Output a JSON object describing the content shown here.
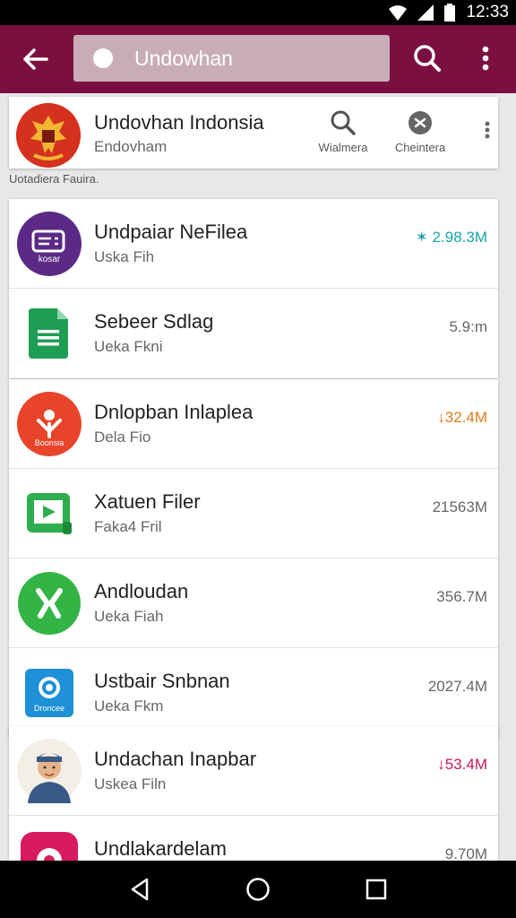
{
  "status_bar": {
    "time": "12:33"
  },
  "app_bar": {
    "search_text": "Undowhan"
  },
  "header": {
    "title": "Undovhan Indonsia",
    "subtitle": "Endovham",
    "actions": [
      {
        "label": "Wialmera",
        "icon": "search-icon"
      },
      {
        "label": "Cheintera",
        "icon": "settings-icon"
      }
    ]
  },
  "section_label": "Uotadiera Fauira.",
  "items": [
    {
      "name": "Undpaiar NeFilea",
      "sub": "Uska Fih",
      "size": "✶ 2.98.3M",
      "size_color": "#1aa3a8",
      "icon_label": "kosar"
    },
    {
      "name": "Sebeer Sdlag",
      "sub": "Ueka Fkni",
      "size": "5.9:m",
      "size_color": "#666666"
    },
    {
      "name": "Dnlopban Inlaplea",
      "sub": "Dela Fio",
      "size": "↓32.4M",
      "size_color": "#e07b1a",
      "icon_label": "Boonsia"
    },
    {
      "name": "Xatuen Filer",
      "sub": "Faka4 Fril",
      "size": "21563M",
      "size_color": "#666666"
    },
    {
      "name": "Andloudan",
      "sub": "Ueka Fiah",
      "size": "356.7M",
      "size_color": "#666666"
    },
    {
      "name": "Ustbair Snbnan",
      "sub": "Ueka Fkm",
      "size": "2027.4M",
      "size_color": "#666666",
      "icon_label": "Droncee"
    },
    {
      "name": "Undachan Inapbar",
      "sub": "Uskea Filn",
      "size": "↓53.4M",
      "size_color": "#c2185b"
    },
    {
      "name": "Undlakardelam",
      "sub": "",
      "size": "9.70M",
      "size_color": "#666666"
    }
  ]
}
